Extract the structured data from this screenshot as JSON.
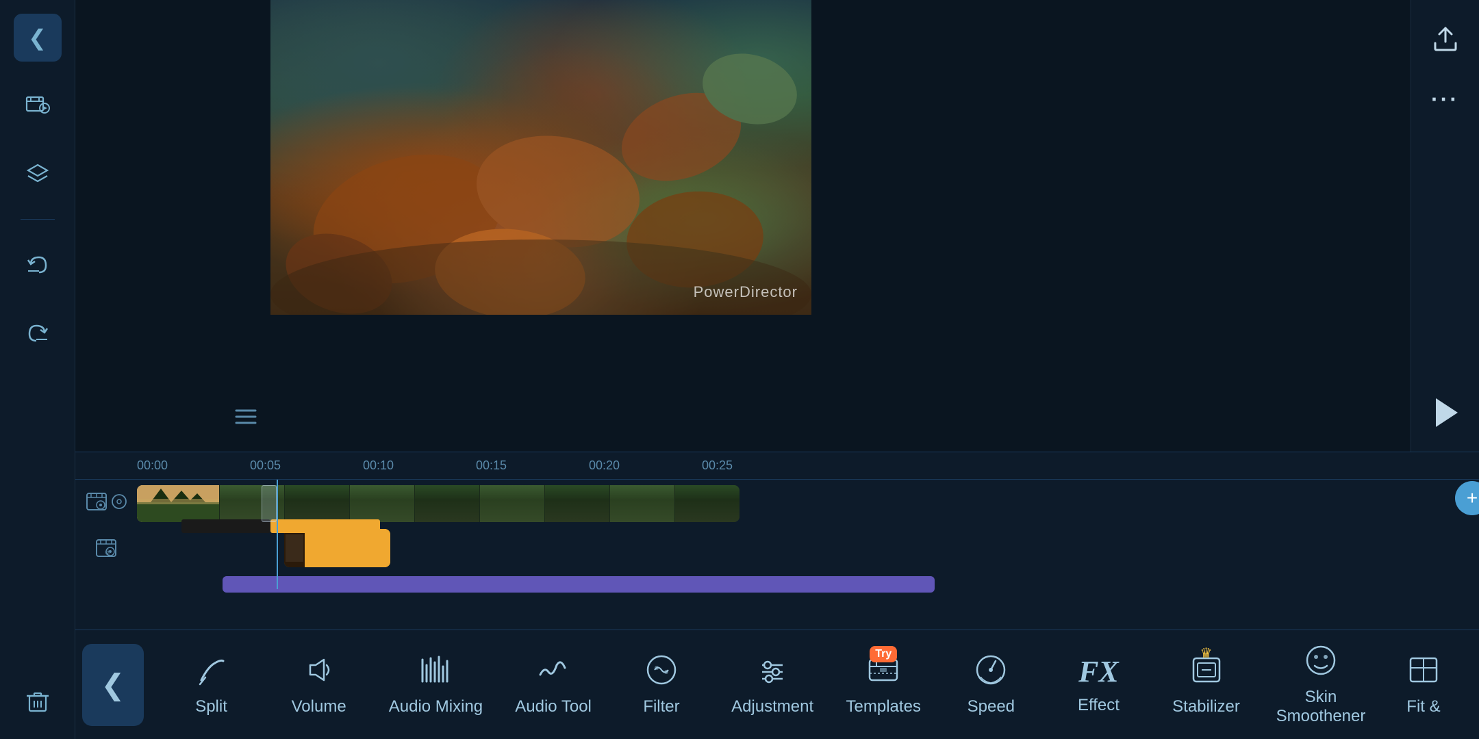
{
  "app": {
    "title": "PowerDirector",
    "watermark": "PowerDirector"
  },
  "left_sidebar": {
    "buttons": [
      {
        "name": "back-button",
        "icon": "❮",
        "label": "Back"
      },
      {
        "name": "media-music-button",
        "icon": "🎞",
        "label": "Media & Music"
      },
      {
        "name": "layers-button",
        "icon": "◇",
        "label": "Layers"
      },
      {
        "name": "undo-button",
        "icon": "↩",
        "label": "Undo"
      },
      {
        "name": "redo-button",
        "icon": "↪",
        "label": "Redo"
      },
      {
        "name": "delete-button",
        "icon": "🗑",
        "label": "Delete"
      }
    ]
  },
  "timeline": {
    "ruler_marks": [
      "00:00",
      "00:05",
      "00:10",
      "00:15",
      "00:20",
      "00:25"
    ]
  },
  "toolbar": {
    "back_label": "❮",
    "tools": [
      {
        "name": "split",
        "label": "Split",
        "icon": "✏",
        "badge": null
      },
      {
        "name": "volume",
        "label": "Volume",
        "icon": "🔈",
        "badge": null
      },
      {
        "name": "audio-mixing",
        "label": "Audio Mixing",
        "icon": "|||",
        "badge": null
      },
      {
        "name": "audio-tool",
        "label": "Audio Tool",
        "icon": "~",
        "badge": null
      },
      {
        "name": "filter",
        "label": "Filter",
        "icon": "⚙",
        "badge": null
      },
      {
        "name": "adjustment",
        "label": "Adjustment",
        "icon": "⊞",
        "badge": null
      },
      {
        "name": "templates",
        "label": "Templates",
        "icon": "⊟",
        "badge": "Try"
      },
      {
        "name": "speed",
        "label": "Speed",
        "icon": "◎",
        "badge": null
      },
      {
        "name": "effect",
        "label": "Effect",
        "icon": "FX",
        "badge": null
      },
      {
        "name": "stabilizer",
        "label": "Stabilizer",
        "icon": "⊡",
        "badge": "crown"
      },
      {
        "name": "skin-smoothener",
        "label": "Skin\nSmoothener",
        "icon": "☺",
        "badge": null
      },
      {
        "name": "fit",
        "label": "Fit &",
        "icon": "▣",
        "badge": null
      }
    ]
  }
}
